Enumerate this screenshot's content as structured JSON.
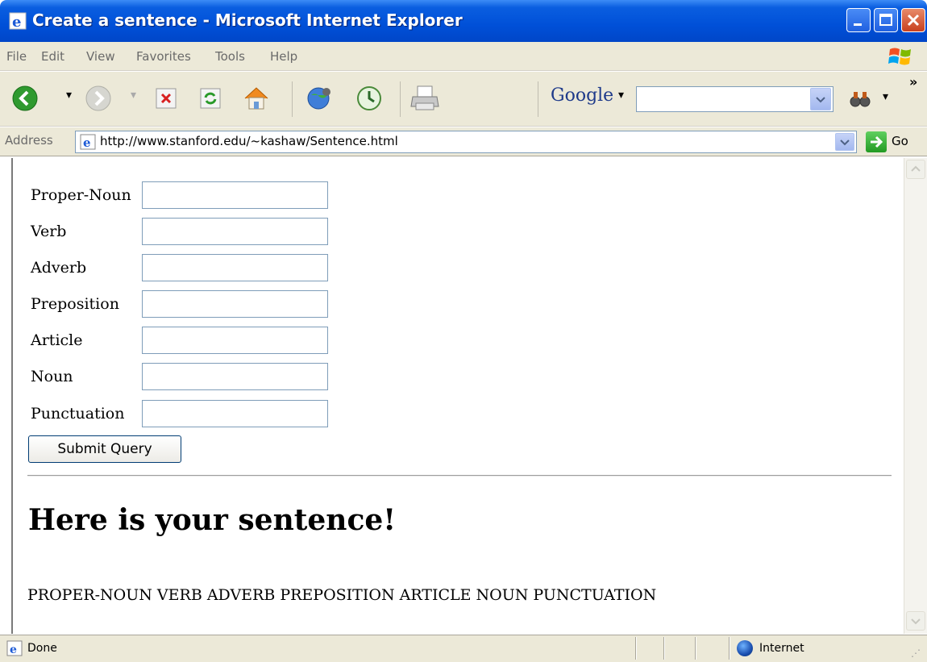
{
  "window": {
    "title": "Create a sentence - Microsoft Internet Explorer"
  },
  "menu": {
    "items": [
      "File",
      "Edit",
      "View",
      "Favorites",
      "Tools",
      "Help"
    ]
  },
  "toolbar": {
    "search_engine_label": "Google",
    "search_engine_arrow": "▾",
    "more_label": "»"
  },
  "address": {
    "label": "Address",
    "url": "http://www.stanford.edu/~kashaw/Sentence.html",
    "go_label": "Go"
  },
  "form": {
    "fields": [
      {
        "label": "Proper-Noun",
        "value": ""
      },
      {
        "label": "Verb",
        "value": ""
      },
      {
        "label": "Adverb",
        "value": ""
      },
      {
        "label": "Preposition",
        "value": ""
      },
      {
        "label": "Article",
        "value": ""
      },
      {
        "label": "Noun",
        "value": ""
      },
      {
        "label": "Punctuation",
        "value": ""
      }
    ],
    "submit_label": "Submit Query"
  },
  "result": {
    "heading": "Here is your sentence!",
    "sentence": "PROPER-NOUN VERB ADVERB PREPOSITION ARTICLE NOUN PUNCTUATION"
  },
  "status": {
    "text": "Done",
    "zone": "Internet"
  }
}
